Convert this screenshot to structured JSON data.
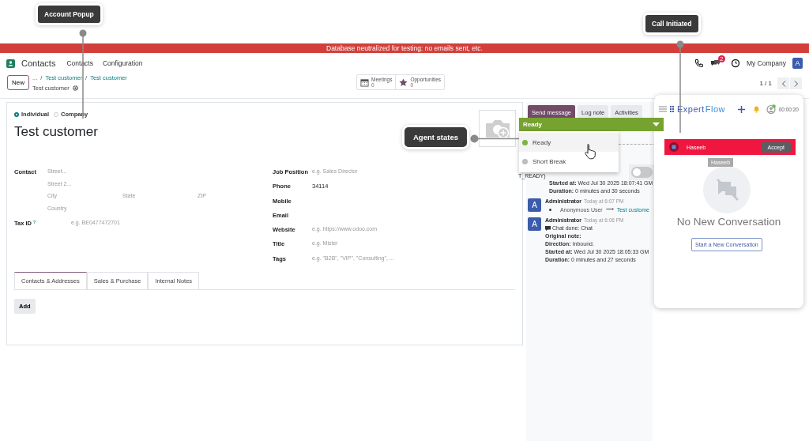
{
  "annotations": [
    {
      "kind": "top-left",
      "label": "Account Popup"
    },
    {
      "kind": "middle",
      "label": "Agent states"
    },
    {
      "kind": "top-right",
      "label": "Call Initiated"
    }
  ],
  "banner": "Database neutralized for testing: no emails sent, etc.",
  "navbar": {
    "app": "Contacts",
    "menu": [
      "Contacts",
      "Configuration"
    ],
    "chat_count": "2",
    "company": "My Company",
    "avatar": "A"
  },
  "control_panel": {
    "new_button": "New",
    "breadcrumbs": [
      {
        "kind": "ellipsis",
        "text": "..."
      },
      {
        "kind": "separator",
        "text": "/"
      },
      {
        "kind": "link",
        "text": "Test customer"
      },
      {
        "kind": "separator",
        "text": "/"
      },
      {
        "kind": "link",
        "text": "Test customer"
      }
    ],
    "record": "Test customer",
    "smart_buttons": [
      {
        "kind": "calendar",
        "label": "Meetings",
        "count": "0"
      },
      {
        "kind": "star",
        "label": "Opportunities",
        "count": "0"
      }
    ],
    "pager": "1 / 1"
  },
  "form": {
    "types": [
      {
        "label": "Individual",
        "selected": true
      },
      {
        "label": "Company",
        "selected": false
      }
    ],
    "name": "Test customer",
    "contact": {
      "label": "Contact",
      "lines": [
        [
          "Street..."
        ],
        [
          "Street 2..."
        ],
        [
          "City",
          "State",
          "ZIP"
        ],
        [
          "Country"
        ]
      ]
    },
    "tax": {
      "label": "Tax ID",
      "help": "?",
      "placeholder": "e.g. BE0477472701"
    },
    "right_fields": [
      {
        "label": "Job Position",
        "placeholder": "e.g. Sales Director"
      },
      {
        "label": "Phone",
        "value": "34114"
      },
      {
        "label": "Mobile"
      },
      {
        "label": "Email"
      },
      {
        "label": "Website",
        "placeholder": "e.g. https://www.odoo.com"
      },
      {
        "label": "Title",
        "placeholder": "e.g. Mister"
      },
      {
        "label": "Tags",
        "placeholder": "e.g. \"B2B\", \"VIP\", \"Consulting\", ..."
      }
    ],
    "tabs": [
      {
        "label": "Contacts & Addresses",
        "selected": true
      },
      {
        "label": "Sales & Purchase",
        "selected": false
      },
      {
        "label": "Internal Notes",
        "selected": false
      }
    ],
    "add_button": "Add"
  },
  "chatter": {
    "buttons": [
      {
        "label": "Send message",
        "kind": "primary"
      },
      {
        "label": "Log note",
        "kind": "secondary"
      },
      {
        "label": "Activities",
        "kind": "secondary"
      }
    ],
    "fragment": "T_READY)",
    "toggle": {
      "on": false
    },
    "messages": [
      {
        "lines": [
          "**Started at:** Wed Jul 30 2025 18:07:41 GM",
          "**Duration:** 0 minutes and 30 seconds"
        ]
      },
      {
        "author": "Administrator",
        "time": "Today at 6:07 PM",
        "avatar": "A",
        "change": {
          "from": "Anonymous User",
          "arrow": "⟶",
          "to": "Test custome"
        }
      },
      {
        "author": "Administrator",
        "time": "Today at 6:06 PM",
        "avatar": "A",
        "lines": [
          "Chat done: Chat",
          "**Original note:**",
          "**Direction:** Inbound.",
          "**Started at:** Wed Jul 30 2025 18:05:33 GM",
          "**Duration:** 0 minutes and 27 seconds"
        ]
      }
    ]
  },
  "agent_state": {
    "current": "Ready",
    "options": [
      {
        "label": "Ready",
        "selected": true,
        "color": "#7cb342"
      },
      {
        "label": "Short Break",
        "selected": false,
        "color": "#bdbdbd"
      }
    ]
  },
  "expertflow": {
    "brand_a": "Expert",
    "brand_b": "Flow",
    "timer": "00:00:20",
    "incoming": {
      "caller": "Haseeb",
      "accept": "Accept"
    },
    "tag": "Haseeb",
    "empty_title": "No New Conversation",
    "start_button": "Start a New Conversation"
  }
}
